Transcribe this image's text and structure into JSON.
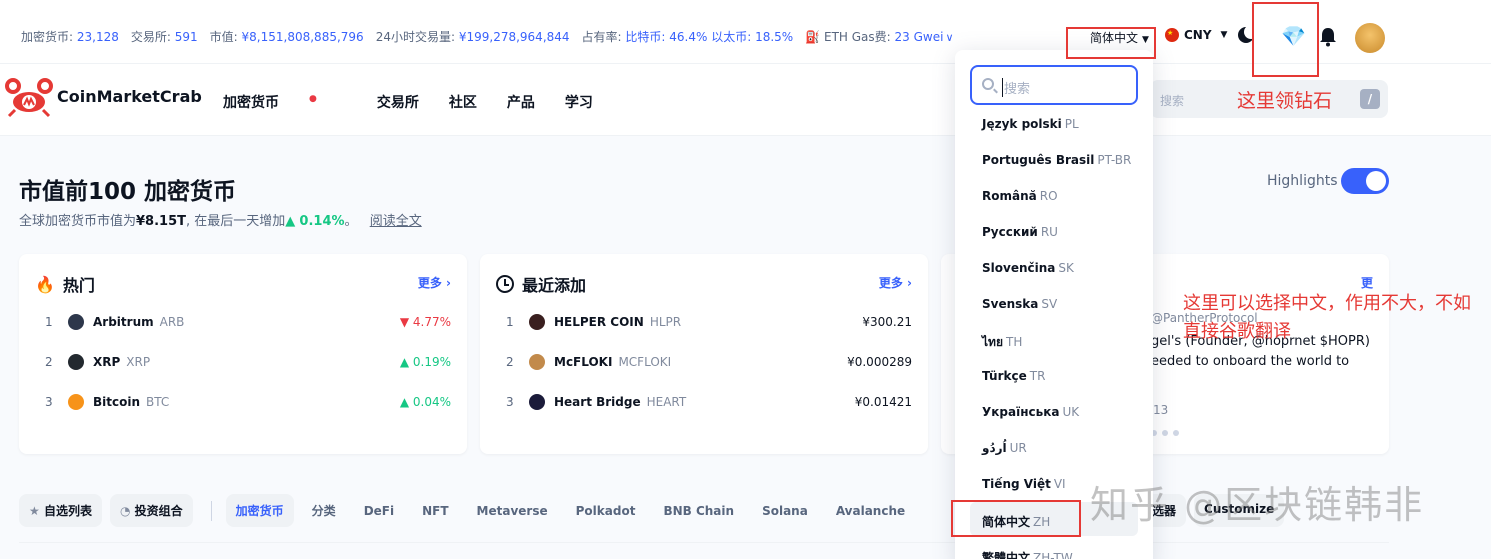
{
  "topbar": {
    "stats": [
      {
        "label": "加密货币:",
        "value": "23,128"
      },
      {
        "label": "交易所:",
        "value": "591"
      },
      {
        "label": "市值:",
        "value": "¥8,151,808,885,796"
      },
      {
        "label": "24小时交易量:",
        "value": "¥199,278,964,844"
      },
      {
        "label": "占有率:",
        "value": "比特币: 46.4% 以太币: 18.5%"
      },
      {
        "label": "ETH Gas费:",
        "value": "23 Gwei"
      }
    ],
    "language": "简体中文",
    "currency": "CNY"
  },
  "nav": {
    "logo": "CoinMarketCrab",
    "links": [
      "加密货币",
      "交易所",
      "社区",
      "产品",
      "学习"
    ],
    "search_placeholder": "搜索",
    "search_shortcut": "/"
  },
  "annotations": {
    "diamond_note": "这里领钻石",
    "language_note": "这里可以选择中文，作用不大，不如直接谷歌翻译"
  },
  "hero": {
    "title": "市值前100 加密货币",
    "sub_prefix": "全球加密货币市值为",
    "sub_value": "¥8.15T",
    "sub_mid": ", 在最后一天增加",
    "sub_change": "0.14%",
    "sub_end": "。",
    "read_more": "阅读全文",
    "highlights_label": "Highlights"
  },
  "trending": {
    "title": "热门",
    "more": "更多",
    "rows": [
      {
        "rank": "1",
        "name": "Arbitrum",
        "symbol": "ARB",
        "change": "4.77%",
        "dir": "down",
        "color": "#2d374b"
      },
      {
        "rank": "2",
        "name": "XRP",
        "symbol": "XRP",
        "change": "0.19%",
        "dir": "up",
        "color": "#23292f"
      },
      {
        "rank": "3",
        "name": "Bitcoin",
        "symbol": "BTC",
        "change": "0.04%",
        "dir": "up",
        "color": "#f7931a"
      }
    ]
  },
  "recent": {
    "title": "最近添加",
    "more": "更多",
    "rows": [
      {
        "rank": "1",
        "name": "HELPER COIN",
        "symbol": "HLPR",
        "price": "¥300.21",
        "color": "#3a1f1f"
      },
      {
        "rank": "2",
        "name": "McFLOKI",
        "symbol": "MCFLOKI",
        "price": "¥0.000289",
        "color": "#c28a4b"
      },
      {
        "rank": "3",
        "name": "Heart Bridge",
        "symbol": "HEART",
        "price": "¥0.01421",
        "color": "#1b1b3a"
      }
    ]
  },
  "news": {
    "more": "更",
    "handle": "@PantherProtocol",
    "line1": "gel's (Founder, @hoprnet $HOPR)",
    "line2": "eeded to onboard the world to",
    "time": "13"
  },
  "tabs": [
    "自选列表",
    "投资组合",
    "加密货币",
    "分类",
    "DeFi",
    "NFT",
    "Metaverse",
    "Polkadot",
    "BNB Chain",
    "Solana",
    "Avalanche"
  ],
  "filters": [
    "筛选器",
    "Customize"
  ],
  "dropdown": {
    "search_placeholder": "搜索",
    "items": [
      {
        "name": "Język polski",
        "code": "PL"
      },
      {
        "name": "Português Brasil",
        "code": "PT-BR"
      },
      {
        "name": "Română",
        "code": "RO"
      },
      {
        "name": "Русский",
        "code": "RU"
      },
      {
        "name": "Slovenčina",
        "code": "SK"
      },
      {
        "name": "Svenska",
        "code": "SV"
      },
      {
        "name": "ไทย",
        "code": "TH"
      },
      {
        "name": "Türkçe",
        "code": "TR"
      },
      {
        "name": "Українська",
        "code": "UK"
      },
      {
        "name": "اُردُو",
        "code": "UR"
      },
      {
        "name": "Tiếng Việt",
        "code": "VI"
      },
      {
        "name": "简体中文",
        "code": "ZH"
      },
      {
        "name": "繁體中文",
        "code": "ZH-TW"
      }
    ]
  },
  "watermark": "知乎 @区块链韩非",
  "colors": {
    "accent": "#3861fb",
    "up": "#16c784",
    "down": "#ea3943",
    "annotation": "#e53935"
  }
}
